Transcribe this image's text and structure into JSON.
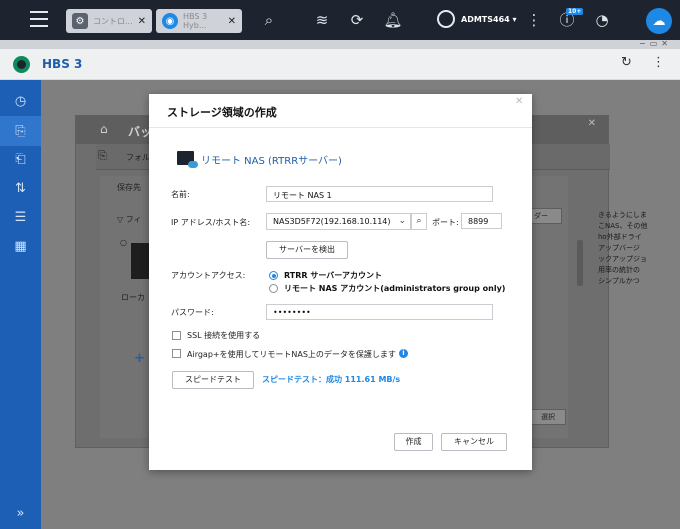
{
  "topbar": {
    "tabs": [
      {
        "label": "コントロ...",
        "icon": "gear-icon"
      },
      {
        "label": "HBS 3 Hyb...",
        "icon": "hbs-icon"
      }
    ],
    "user": "ADMTS464 ▾",
    "notification_badge": "10+"
  },
  "app": {
    "title": "HBS 3"
  },
  "background": {
    "panel_title": "バッ",
    "folder_label": "フォルダ",
    "save_label": "保存先",
    "filter_label": "フィ",
    "local_label": "ローカ",
    "folder_btn": "ダー",
    "select_btn": "選択",
    "right_text": [
      "きるようにしま",
      "こNAS、その他",
      "ho外部ドライ",
      "アップバージ",
      "ックアップジョ",
      "用率の統計の",
      "シンプルかつ"
    ]
  },
  "dialog": {
    "title": "ストレージ領域の作成",
    "section_title": "リモート NAS (RTRRサーバー)",
    "name_label": "名前:",
    "name_value": "リモート NAS 1",
    "ip_label": "IP アドレス/ホスト名:",
    "ip_value": "NAS3D5F72(192.168.10.114)",
    "port_label": "ポート:",
    "port_value": "8899",
    "detect_button": "サーバーを検出",
    "account_label": "アカウントアクセス:",
    "account_options": [
      {
        "label": "RTRR サーバーアカウント",
        "selected": true
      },
      {
        "label": "リモート NAS アカウント(administrators group only)",
        "selected": false
      }
    ],
    "password_label": "パスワード:",
    "password_value": "••••••••",
    "ssl_label": "SSL 接続を使用する",
    "airgap_label": "Airgap+を使用してリモートNAS上のデータを保護します",
    "speed_test_button": "スピードテスト",
    "speed_test_result": "スピードテスト：成功 111.61 MB/s",
    "create_button": "作成",
    "cancel_button": "キャンセル"
  }
}
